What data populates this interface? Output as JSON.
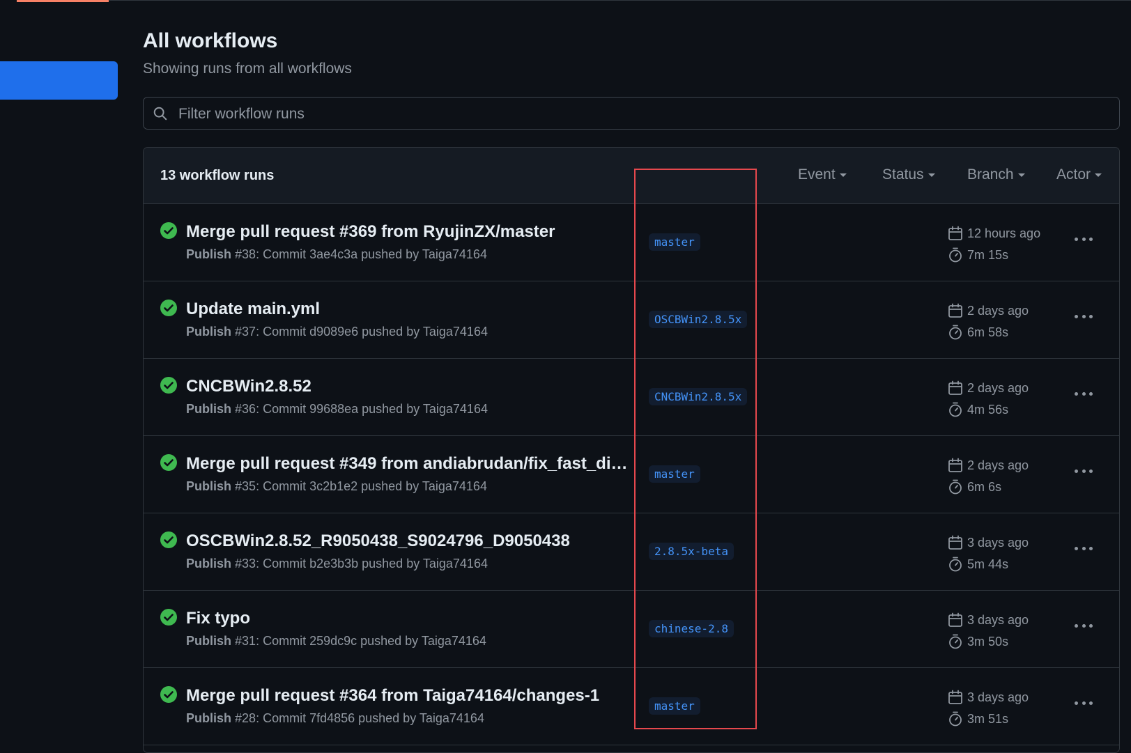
{
  "header": {
    "title": "All workflows",
    "subtitle": "Showing runs from all workflows"
  },
  "search": {
    "placeholder": "Filter workflow runs",
    "value": ""
  },
  "runs_table": {
    "count_label": "13 workflow runs",
    "filters": [
      "Event",
      "Status",
      "Branch",
      "Actor"
    ]
  },
  "runs": [
    {
      "title": "Merge pull request #369 from RyujinZX/master",
      "workflow": "Publish",
      "meta": "#38: Commit 3ae4c3a pushed by Taiga74164",
      "branch": "master",
      "ago": "12 hours ago",
      "duration": "7m 15s"
    },
    {
      "title": "Update main.yml",
      "workflow": "Publish",
      "meta": "#37: Commit d9089e6 pushed by Taiga74164",
      "branch": "OSCBWin2.8.5x",
      "ago": "2 days ago",
      "duration": "6m 58s"
    },
    {
      "title": "CNCBWin2.8.52",
      "workflow": "Publish",
      "meta": "#36: Commit 99688ea pushed by Taiga74164",
      "branch": "CNCBWin2.8.5x",
      "ago": "2 days ago",
      "duration": "4m 56s"
    },
    {
      "title": "Merge pull request #349 from andiabrudan/fix_fast_dial…",
      "workflow": "Publish",
      "meta": "#35: Commit 3c2b1e2 pushed by Taiga74164",
      "branch": "master",
      "ago": "2 days ago",
      "duration": "6m 6s"
    },
    {
      "title": "OSCBWin2.8.52_R9050438_S9024796_D9050438",
      "workflow": "Publish",
      "meta": "#33: Commit b2e3b3b pushed by Taiga74164",
      "branch": "2.8.5x-beta",
      "ago": "3 days ago",
      "duration": "5m 44s"
    },
    {
      "title": "Fix typo",
      "workflow": "Publish",
      "meta": "#31: Commit 259dc9c pushed by Taiga74164",
      "branch": "chinese-2.8",
      "ago": "3 days ago",
      "duration": "3m 50s"
    },
    {
      "title": "Merge pull request #364 from Taiga74164/changes-1",
      "workflow": "Publish",
      "meta": "#28: Commit 7fd4856 pushed by Taiga74164",
      "branch": "master",
      "ago": "3 days ago",
      "duration": "3m 51s"
    }
  ],
  "colors": {
    "background": "#0d1117",
    "accent": "#1f6feb",
    "success": "#3fb950",
    "link": "#4493f8",
    "highlight": "#e5484d"
  },
  "icons": {
    "search": "search-icon",
    "status": "check-circle-icon",
    "ago": "calendar-icon",
    "duration": "stopwatch-icon",
    "more": "kebab-horizontal-icon"
  }
}
